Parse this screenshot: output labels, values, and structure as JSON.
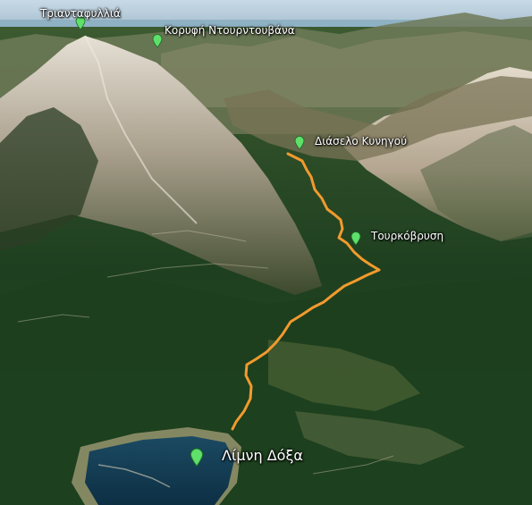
{
  "map": {
    "type": "satellite-3d",
    "colors": {
      "route": "#f29a2e",
      "pin": "#5ee06a",
      "label": "#ffffff",
      "lake": "#0f3a52",
      "forest": "#1f4a22",
      "rock": "#cfc8bb"
    },
    "places": [
      {
        "id": "triantafyllia",
        "label": "Τριανταφυλλιά",
        "icon": "map-pin-icon"
      },
      {
        "id": "ntourntouvana",
        "label": "Κορυφή Ντουρντουβάνα",
        "icon": "map-pin-icon"
      },
      {
        "id": "kynigou",
        "label": "Διάσελο Κυνηγού",
        "icon": "map-pin-icon"
      },
      {
        "id": "tourkovrysi",
        "label": "Τουρκόβρυση",
        "icon": "map-pin-icon"
      },
      {
        "id": "doxa",
        "label": "Λίμνη Δόξα",
        "icon": "map-pin-icon"
      }
    ],
    "route": {
      "name": "",
      "color": "#f29a2e"
    }
  }
}
